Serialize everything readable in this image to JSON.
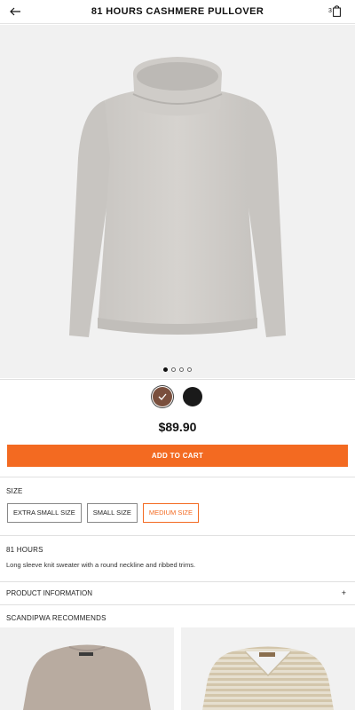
{
  "header": {
    "title": "81 HOURS CASHMERE PULLOVER",
    "back_icon": "arrow-left-icon",
    "cart_icon": "shopping-bag-icon",
    "cart_count": "3"
  },
  "gallery": {
    "image_description": "light grey cowl-neck cashmere sweater",
    "dots_total": 4,
    "active_dot": 1
  },
  "swatches": [
    {
      "color": "#7a4f3d",
      "selected": true
    },
    {
      "color": "#1a1a1a",
      "selected": false
    }
  ],
  "price": "$89.90",
  "add_to_cart_label": "ADD TO CART",
  "accent_color": "#f36a21",
  "size": {
    "label": "SIZE",
    "options": [
      "EXTRA SMALL SIZE",
      "SMALL SIZE",
      "MEDIUM SIZE"
    ],
    "selected": "MEDIUM SIZE"
  },
  "brand": "81 HOURS",
  "description": "Long sleeve knit sweater with a round neckline and ribbed trims.",
  "product_information_label": "PRODUCT INFORMATION",
  "product_information_toggle": "+",
  "recommendations_label": "SCANDIPWA RECOMMENDS"
}
